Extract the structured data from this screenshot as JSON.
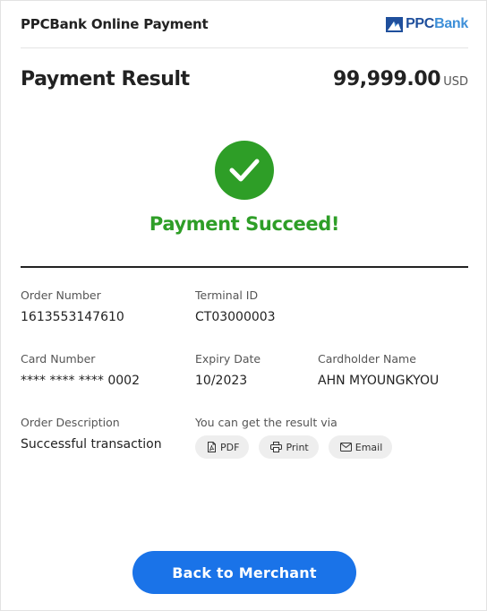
{
  "header": {
    "title": "PPCBank Online Payment",
    "logo_text_main": "PPC",
    "logo_text_accent": "Bank"
  },
  "result": {
    "title": "Payment Result",
    "amount": "99,999.00",
    "currency": "USD"
  },
  "status": {
    "message": "Payment Succeed!",
    "icon": "check-circle-icon"
  },
  "details": {
    "order_number": {
      "label": "Order Number",
      "value": "1613553147610"
    },
    "terminal_id": {
      "label": "Terminal ID",
      "value": "CT03000003"
    },
    "card_number": {
      "label": "Card Number",
      "value": "**** **** **** 0002"
    },
    "expiry_date": {
      "label": "Expiry Date",
      "value": "10/2023"
    },
    "cardholder_name": {
      "label": "Cardholder Name",
      "value": "AHN MYOUNGKYOU"
    },
    "order_description": {
      "label": "Order Description",
      "value": "Successful transaction"
    }
  },
  "share": {
    "label": "You can get the result via",
    "buttons": [
      {
        "label": "PDF",
        "icon": "pdf-file-icon"
      },
      {
        "label": "Print",
        "icon": "printer-icon"
      },
      {
        "label": "Email",
        "icon": "envelope-icon"
      }
    ]
  },
  "actions": {
    "back_label": "Back to Merchant"
  },
  "colors": {
    "success_green": "#2e9e27",
    "primary_blue": "#1a73e8",
    "logo_navy": "#1f4f9c",
    "logo_light_blue": "#3d8fd8"
  }
}
